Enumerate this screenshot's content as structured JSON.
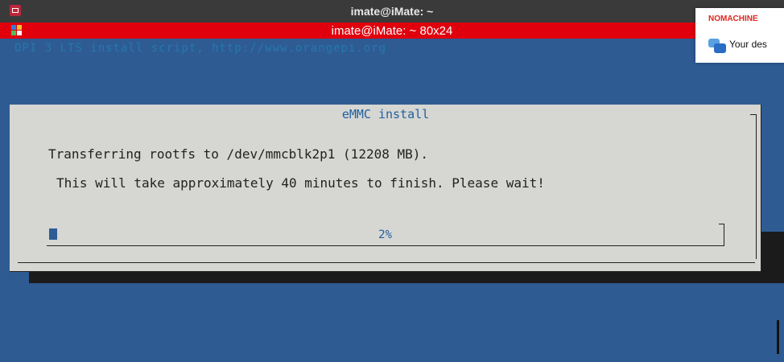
{
  "window": {
    "outer_title": "imate@iMate: ~",
    "inner_title": "imate@iMate: ~ 80x24"
  },
  "terminal": {
    "backtitle": "OPI 3 LTS install script, http://www.orangepi.org",
    "dialog": {
      "title": "eMMC install",
      "line1": "Transferring rootfs to /dev/mmcblk2p1 (12208 MB).",
      "line2": "This will take approximately 40 minutes to finish. Please wait!",
      "progress_label": "2%",
      "progress_percent": 2
    }
  },
  "notification": {
    "brand": "NOMACHINE",
    "message": "Your des"
  },
  "colors": {
    "terminal_bg": "#2f5b93",
    "dialog_bg": "#d6d6d2",
    "inner_titlebar": "#e0000d",
    "progress_fill": "#2d5c96",
    "brand_red": "#e0261d"
  },
  "icons": {
    "outer_app": "terminal-icon",
    "inner_app": "app-grid-icon",
    "notification": "chat-bubbles-icon"
  }
}
